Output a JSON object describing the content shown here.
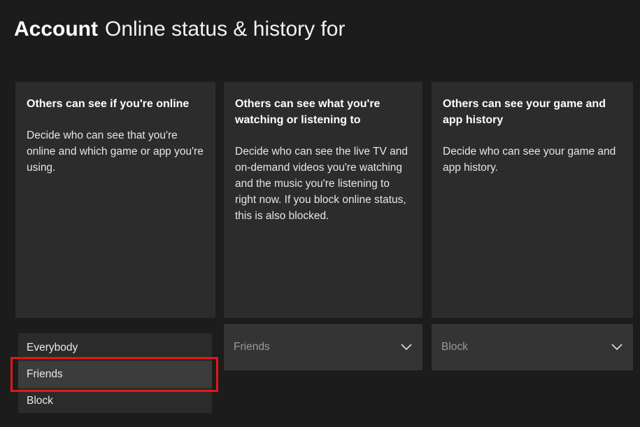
{
  "header": {
    "section": "Account",
    "title": "Online status & history for"
  },
  "cards": [
    {
      "title": "Others can see if you're online",
      "description": "Decide who can see that you're online and which game or app you're using."
    },
    {
      "title": "Others can see what you're watching or listening to",
      "description": "Decide who can see the live TV and on-demand videos you're watching and the music you're listening to right now. If you block online status, this is also blocked."
    },
    {
      "title": "Others can see your game and app history",
      "description": "Decide who can see your game and app history."
    }
  ],
  "online_dropdown": {
    "options": [
      "Everybody",
      "Friends",
      "Block"
    ],
    "focused": "Friends"
  },
  "watching_dropdown": {
    "value": "Friends",
    "icon": "chevron-down-icon"
  },
  "history_dropdown": {
    "value": "Block",
    "icon": "chevron-down-icon"
  },
  "colors": {
    "background": "#1c1c1c",
    "card": "#2c2c2c",
    "dropdown": "#343434",
    "highlight": "#e11717"
  }
}
